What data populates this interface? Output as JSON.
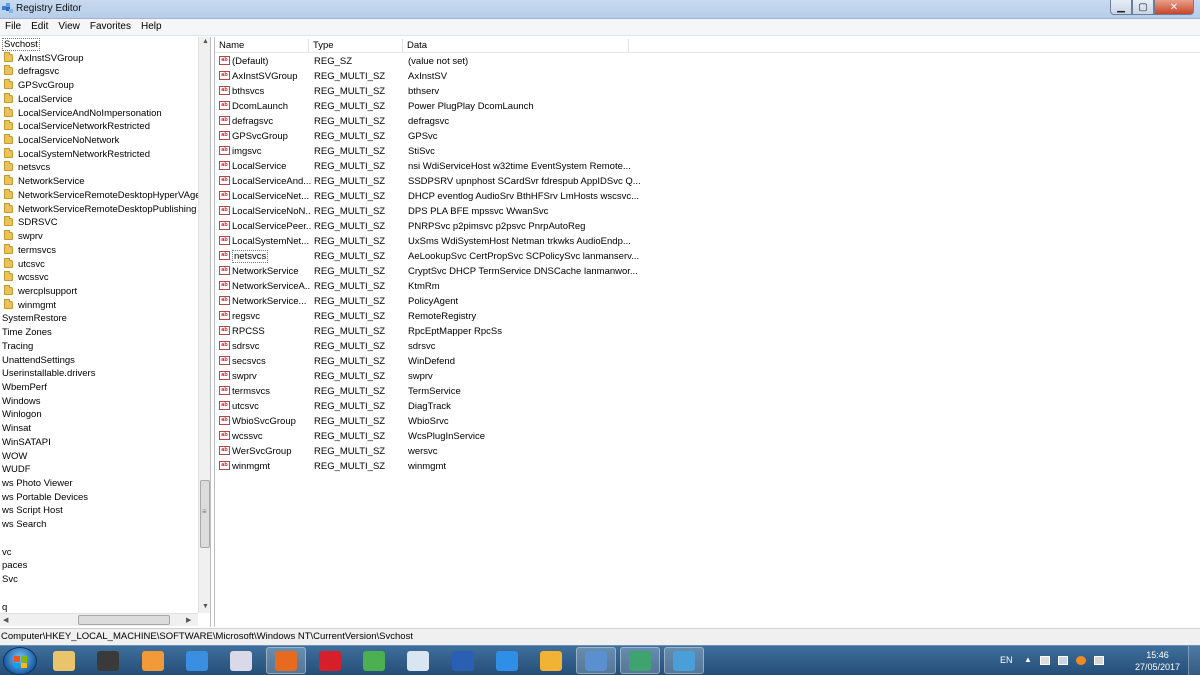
{
  "window": {
    "title": "Registry Editor",
    "minimize_glyph": "▁",
    "maximize_glyph": "▢",
    "close_glyph": "✕"
  },
  "menu": [
    "File",
    "Edit",
    "View",
    "Favorites",
    "Help"
  ],
  "tree": {
    "selected": "Svchost",
    "items": [
      {
        "label": "Svchost",
        "folder": false
      },
      {
        "label": "AxInstSVGroup",
        "folder": true
      },
      {
        "label": "defragsvc",
        "folder": true
      },
      {
        "label": "GPSvcGroup",
        "folder": true
      },
      {
        "label": "LocalService",
        "folder": true
      },
      {
        "label": "LocalServiceAndNoImpersonation",
        "folder": true
      },
      {
        "label": "LocalServiceNetworkRestricted",
        "folder": true
      },
      {
        "label": "LocalServiceNoNetwork",
        "folder": true
      },
      {
        "label": "LocalSystemNetworkRestricted",
        "folder": true
      },
      {
        "label": "netsvcs",
        "folder": true
      },
      {
        "label": "NetworkService",
        "folder": true
      },
      {
        "label": "NetworkServiceRemoteDesktopHyperVAgent",
        "folder": true
      },
      {
        "label": "NetworkServiceRemoteDesktopPublishing",
        "folder": true
      },
      {
        "label": "SDRSVC",
        "folder": true
      },
      {
        "label": "swprv",
        "folder": true
      },
      {
        "label": "termsvcs",
        "folder": true
      },
      {
        "label": "utcsvc",
        "folder": true
      },
      {
        "label": "wcssvc",
        "folder": true
      },
      {
        "label": "wercplsupport",
        "folder": true
      },
      {
        "label": "winmgmt",
        "folder": true
      },
      {
        "label": "SystemRestore",
        "folder": false
      },
      {
        "label": "Time Zones",
        "folder": false
      },
      {
        "label": "Tracing",
        "folder": false
      },
      {
        "label": "UnattendSettings",
        "folder": false
      },
      {
        "label": "Userinstallable.drivers",
        "folder": false
      },
      {
        "label": "WbemPerf",
        "folder": false
      },
      {
        "label": "Windows",
        "folder": false
      },
      {
        "label": "Winlogon",
        "folder": false
      },
      {
        "label": "Winsat",
        "folder": false
      },
      {
        "label": "WinSATAPI",
        "folder": false
      },
      {
        "label": "WOW",
        "folder": false
      },
      {
        "label": "WUDF",
        "folder": false
      },
      {
        "label": "ws Photo Viewer",
        "folder": false
      },
      {
        "label": "ws Portable Devices",
        "folder": false
      },
      {
        "label": "ws Script Host",
        "folder": false
      },
      {
        "label": "ws Search",
        "folder": false
      },
      {
        "label": "",
        "folder": false
      },
      {
        "label": "vc",
        "folder": false
      },
      {
        "label": "paces",
        "folder": false
      },
      {
        "label": "Svc",
        "folder": false
      },
      {
        "label": "",
        "folder": false
      },
      {
        "label": "q",
        "folder": false
      }
    ]
  },
  "list": {
    "columns": [
      "Name",
      "Type",
      "Data"
    ],
    "selected": "netsvcs",
    "rows": [
      {
        "name": "(Default)",
        "type": "REG_SZ",
        "data": "(value not set)"
      },
      {
        "name": "AxInstSVGroup",
        "type": "REG_MULTI_SZ",
        "data": "AxInstSV"
      },
      {
        "name": "bthsvcs",
        "type": "REG_MULTI_SZ",
        "data": "bthserv"
      },
      {
        "name": "DcomLaunch",
        "type": "REG_MULTI_SZ",
        "data": "Power PlugPlay DcomLaunch"
      },
      {
        "name": "defragsvc",
        "type": "REG_MULTI_SZ",
        "data": "defragsvc"
      },
      {
        "name": "GPSvcGroup",
        "type": "REG_MULTI_SZ",
        "data": "GPSvc"
      },
      {
        "name": "imgsvc",
        "type": "REG_MULTI_SZ",
        "data": "StiSvc"
      },
      {
        "name": "LocalService",
        "type": "REG_MULTI_SZ",
        "data": "nsi WdiServiceHost w32time EventSystem Remote..."
      },
      {
        "name": "LocalServiceAnd...",
        "type": "REG_MULTI_SZ",
        "data": "SSDPSRV upnphost SCardSvr fdrespub AppIDSvc Q..."
      },
      {
        "name": "LocalServiceNet...",
        "type": "REG_MULTI_SZ",
        "data": "DHCP eventlog AudioSrv BthHFSrv LmHosts wscsvc..."
      },
      {
        "name": "LocalServiceNoN...",
        "type": "REG_MULTI_SZ",
        "data": "DPS PLA BFE mpssvc WwanSvc"
      },
      {
        "name": "LocalServicePeer...",
        "type": "REG_MULTI_SZ",
        "data": "PNRPSvc p2pimsvc p2psvc PnrpAutoReg"
      },
      {
        "name": "LocalSystemNet...",
        "type": "REG_MULTI_SZ",
        "data": "UxSms WdiSystemHost Netman trkwks AudioEndp..."
      },
      {
        "name": "netsvcs",
        "type": "REG_MULTI_SZ",
        "data": "AeLookupSvc CertPropSvc SCPolicySvc lanmanserv..."
      },
      {
        "name": "NetworkService",
        "type": "REG_MULTI_SZ",
        "data": "CryptSvc DHCP TermService DNSCache lanmanwor..."
      },
      {
        "name": "NetworkServiceA...",
        "type": "REG_MULTI_SZ",
        "data": "KtmRm"
      },
      {
        "name": "NetworkService...",
        "type": "REG_MULTI_SZ",
        "data": "PolicyAgent"
      },
      {
        "name": "regsvc",
        "type": "REG_MULTI_SZ",
        "data": "RemoteRegistry"
      },
      {
        "name": "RPCSS",
        "type": "REG_MULTI_SZ",
        "data": "RpcEptMapper RpcSs"
      },
      {
        "name": "sdrsvc",
        "type": "REG_MULTI_SZ",
        "data": "sdrsvc"
      },
      {
        "name": "secsvcs",
        "type": "REG_MULTI_SZ",
        "data": "WinDefend"
      },
      {
        "name": "swprv",
        "type": "REG_MULTI_SZ",
        "data": "swprv"
      },
      {
        "name": "termsvcs",
        "type": "REG_MULTI_SZ",
        "data": "TermService"
      },
      {
        "name": "utcsvc",
        "type": "REG_MULTI_SZ",
        "data": "DiagTrack"
      },
      {
        "name": "WbioSvcGroup",
        "type": "REG_MULTI_SZ",
        "data": "WbioSrvc"
      },
      {
        "name": "wcssvc",
        "type": "REG_MULTI_SZ",
        "data": "WcsPlugInService"
      },
      {
        "name": "WerSvcGroup",
        "type": "REG_MULTI_SZ",
        "data": "wersvc"
      },
      {
        "name": "winmgmt",
        "type": "REG_MULTI_SZ",
        "data": "winmgmt"
      }
    ]
  },
  "statusbar": {
    "path": "Computer\\HKEY_LOCAL_MACHINE\\SOFTWARE\\Microsoft\\Windows NT\\CurrentVersion\\Svchost"
  },
  "taskbar": {
    "apps": [
      {
        "name": "file-explorer",
        "color": "#e9c46a",
        "active": false
      },
      {
        "name": "terminal",
        "color": "#3a3a3a",
        "active": false
      },
      {
        "name": "media-player",
        "color": "#f29a38",
        "active": false
      },
      {
        "name": "internet-explorer",
        "color": "#3a8fe0",
        "active": false
      },
      {
        "name": "itunes",
        "color": "#d9d9e8",
        "active": false
      },
      {
        "name": "firefox",
        "color": "#e66a1f",
        "active": true
      },
      {
        "name": "opera",
        "color": "#d61f2a",
        "active": false
      },
      {
        "name": "chrome",
        "color": "#4caf50",
        "active": false
      },
      {
        "name": "mail",
        "color": "#d9e6f2",
        "active": false
      },
      {
        "name": "word",
        "color": "#2b5fb4",
        "active": false
      },
      {
        "name": "onedrive",
        "color": "#2f8fe6",
        "active": false
      },
      {
        "name": "windows-tools",
        "color": "#f2b233",
        "active": false
      },
      {
        "name": "backup",
        "color": "#5a8fd0",
        "active": true
      },
      {
        "name": "performance-monitor",
        "color": "#3fa370",
        "active": true
      },
      {
        "name": "registry-editor",
        "color": "#4a9fd8",
        "active": true
      }
    ],
    "language": "EN",
    "time": "15:46",
    "date": "27/05/2017"
  }
}
